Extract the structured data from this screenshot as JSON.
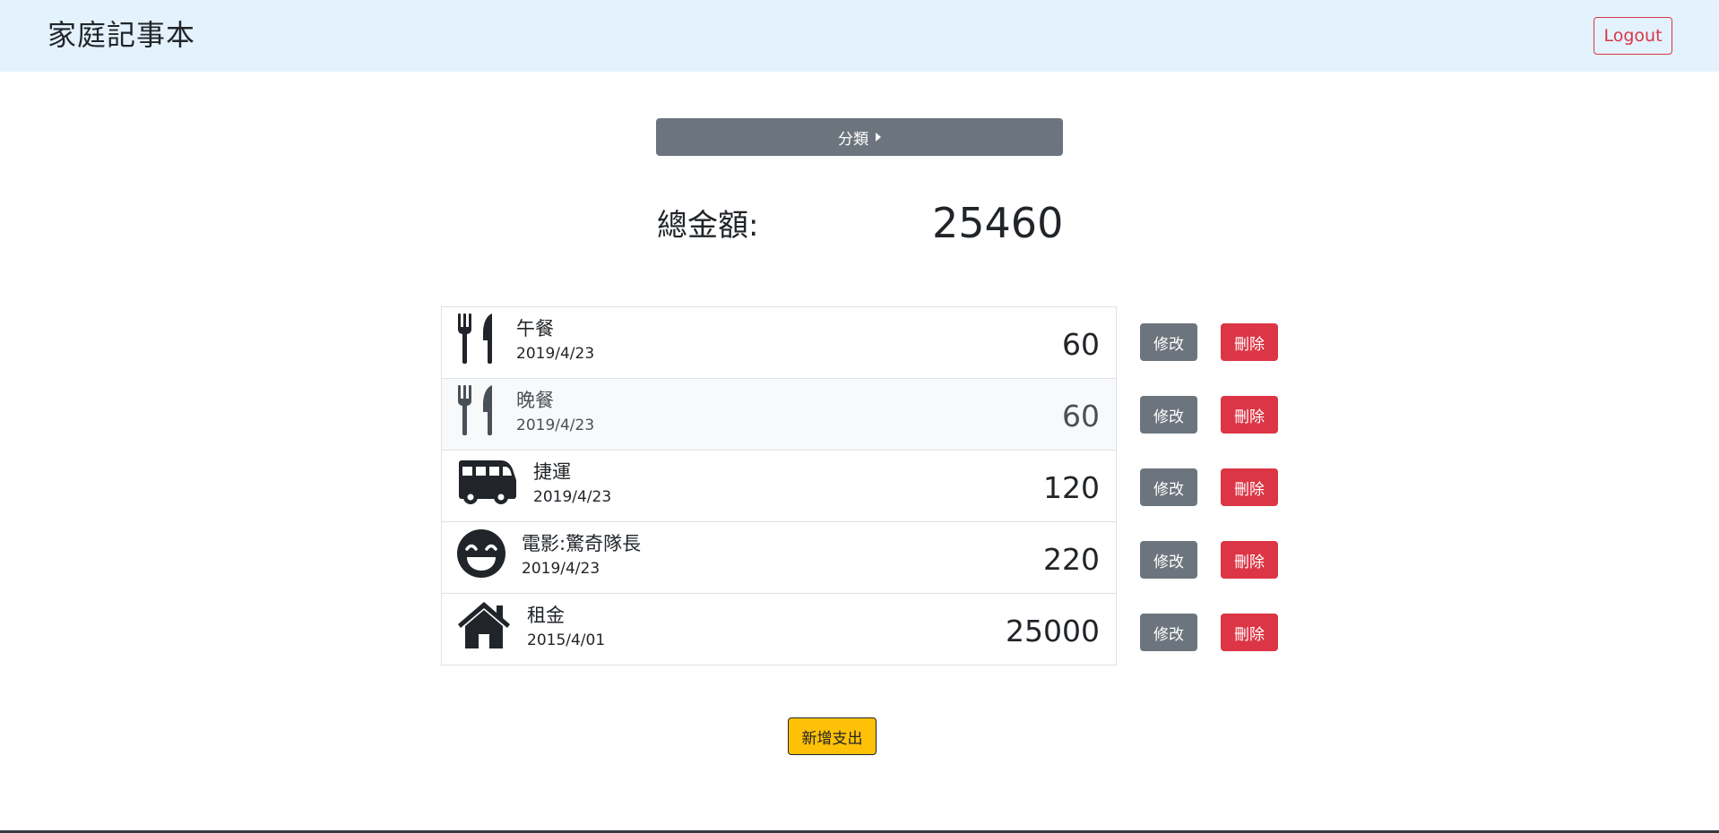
{
  "navbar": {
    "brand": "家庭記事本",
    "logout_label": "Logout"
  },
  "category_button": {
    "label": "分類",
    "caret_icon": "caret-right-icon"
  },
  "total": {
    "label": "總金額:",
    "value": "25460"
  },
  "expenses": [
    {
      "icon": "utensils-icon",
      "name": "午餐",
      "date": "2019/4/23",
      "amount": "60"
    },
    {
      "icon": "utensils-icon",
      "name": "晚餐",
      "date": "2019/4/23",
      "amount": "60"
    },
    {
      "icon": "bus-icon",
      "name": "捷運",
      "date": "2019/4/23",
      "amount": "120"
    },
    {
      "icon": "grin-face-icon",
      "name": "電影:驚奇隊長",
      "date": "2019/4/23",
      "amount": "220"
    },
    {
      "icon": "home-icon",
      "name": "租金",
      "date": "2015/4/01",
      "amount": "25000"
    }
  ],
  "actions": {
    "edit_label": "修改",
    "delete_label": "刪除"
  },
  "add_button_label": "新增支出",
  "colors": {
    "navbar_bg": "#e3f2fd",
    "secondary": "#6c757d",
    "danger": "#dc3545",
    "warning": "#ffc107"
  }
}
